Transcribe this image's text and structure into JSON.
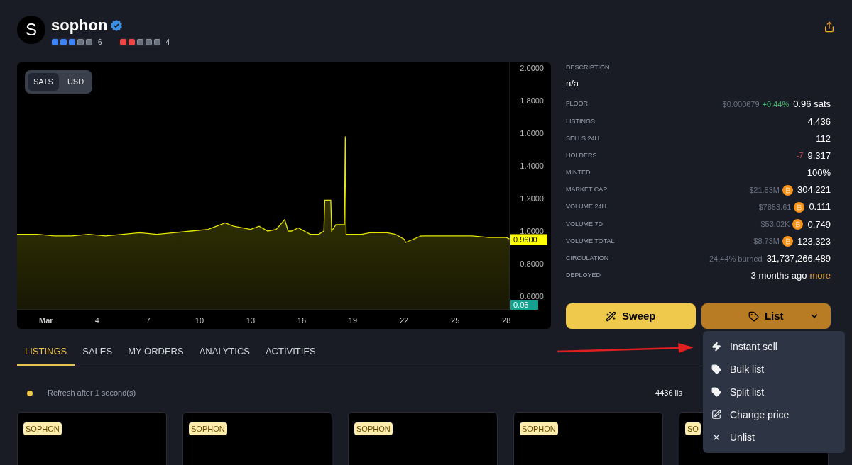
{
  "collection": {
    "avatar_letter": "S",
    "name": "sophon",
    "verified": true,
    "ratings": [
      {
        "color": "#3b82f6",
        "stars": 3,
        "count": "6"
      },
      {
        "color": "#ef4444",
        "stars": 2,
        "count": "4"
      }
    ]
  },
  "chart": {
    "toggle": [
      {
        "label": "SATS",
        "selected": true
      },
      {
        "label": "USD",
        "selected": false
      }
    ],
    "last_price_label": "0.9600",
    "volume_label": "0.05",
    "chart_data": {
      "type": "area",
      "xlim": [
        -0.7,
        28.2
      ],
      "ylim": [
        0.517,
        2.035
      ],
      "xticks": [
        {
          "value": 1,
          "label": "Mar"
        },
        {
          "value": 4,
          "label": "4"
        },
        {
          "value": 7,
          "label": "7"
        },
        {
          "value": 10,
          "label": "10"
        },
        {
          "value": 13,
          "label": "13"
        },
        {
          "value": 16,
          "label": "16"
        },
        {
          "value": 19,
          "label": "19"
        },
        {
          "value": 22,
          "label": "22"
        },
        {
          "value": 25,
          "label": "25"
        },
        {
          "value": 28,
          "label": "28"
        }
      ],
      "yticks": [
        {
          "value": 0.6,
          "label": "0.6000"
        },
        {
          "value": 0.8,
          "label": "0.8000"
        },
        {
          "value": 1.0,
          "label": "1.0000"
        },
        {
          "value": 1.2,
          "label": "1.2000"
        },
        {
          "value": 1.4,
          "label": "1.4000"
        },
        {
          "value": 1.6,
          "label": "1.6000"
        },
        {
          "value": 1.8,
          "label": "1.8000"
        },
        {
          "value": 2.0,
          "label": "2.0000"
        }
      ],
      "x": [
        -0.7,
        0.5,
        1.5,
        2.5,
        3.5,
        4.5,
        5.5,
        6.5,
        7.5,
        8.5,
        9.5,
        10.5,
        11,
        11.5,
        12,
        12.5,
        13,
        13.5,
        14,
        14.5,
        15,
        15.2,
        15.4,
        15.8,
        16.5,
        17,
        17.3,
        17.35,
        17.7,
        17.75,
        18,
        18.3,
        18.5,
        18.55,
        18.6,
        19,
        19.5,
        20,
        21,
        21.5,
        22,
        22.1,
        23,
        24,
        25,
        26,
        27,
        28,
        28.2
      ],
      "series": [
        {
          "color": "#e6e600",
          "values": [
            0.98,
            0.98,
            0.97,
            0.97,
            0.98,
            0.97,
            0.98,
            0.99,
            0.98,
            0.99,
            1.0,
            1.01,
            1.03,
            1.05,
            1.03,
            1.02,
            1.01,
            1.03,
            1.0,
            1.01,
            1.07,
            1.0,
            1.0,
            1.02,
            0.98,
            0.98,
            1.0,
            1.19,
            1.19,
            1.0,
            1.04,
            1.04,
            1.04,
            1.58,
            0.98,
            0.98,
            0.98,
            0.99,
            0.99,
            0.98,
            0.95,
            0.93,
            0.97,
            0.97,
            0.97,
            0.97,
            0.96,
            0.96,
            0.95
          ]
        }
      ]
    }
  },
  "info": {
    "description_label": "DESCRIPTION",
    "description": "n/a",
    "rows": [
      {
        "label": "FLOOR",
        "sub": "$0.000679",
        "change": "+0.44%",
        "positive": true,
        "value": "0.96 sats"
      },
      {
        "label": "LISTINGS",
        "value": "4,436"
      },
      {
        "label": "SELLS 24H",
        "value": "112"
      },
      {
        "label": "HOLDERS",
        "change": "-7",
        "positive": false,
        "value": "9,317"
      },
      {
        "label": "MINTED",
        "value": "100%"
      },
      {
        "label": "MARKET CAP",
        "sub": "$21.53M",
        "coin": true,
        "value": "304.221"
      },
      {
        "label": "VOLUME 24H",
        "sub": "$7853.61",
        "coin": true,
        "value": "0.111"
      },
      {
        "label": "VOLUME 7D",
        "sub": "$53.02K",
        "coin": true,
        "value": "0.749"
      },
      {
        "label": "VOLUME TOTAL",
        "sub": "$8.73M",
        "coin": true,
        "value": "123.323"
      },
      {
        "label": "CIRCULATION",
        "sub": "24.44% burned",
        "value": "31,737,266,489"
      },
      {
        "label": "DEPLOYED",
        "value": "3 months ago",
        "link": "more"
      }
    ]
  },
  "actions": {
    "sweep": "Sweep",
    "list": "List"
  },
  "tabs": [
    {
      "label": "LISTINGS",
      "selected": true
    },
    {
      "label": "SALES",
      "selected": false
    },
    {
      "label": "MY ORDERS",
      "selected": false
    },
    {
      "label": "ANALYTICS",
      "selected": false
    },
    {
      "label": "ACTIVITIES",
      "selected": false
    }
  ],
  "refresh": {
    "text": "Refresh after 1 second(s)",
    "count": "4436 lis"
  },
  "cards": [
    {
      "tag": "SOPHON"
    },
    {
      "tag": "SOPHON"
    },
    {
      "tag": "SOPHON"
    },
    {
      "tag": "SOPHON"
    },
    {
      "tag": "SO"
    }
  ],
  "menu": [
    {
      "kind": "bolt",
      "label": "Instant sell"
    },
    {
      "kind": "tag",
      "label": "Bulk list"
    },
    {
      "kind": "tag",
      "label": "Split list"
    },
    {
      "kind": "edit",
      "label": "Change price"
    },
    {
      "kind": "close",
      "label": "Unlist"
    }
  ]
}
